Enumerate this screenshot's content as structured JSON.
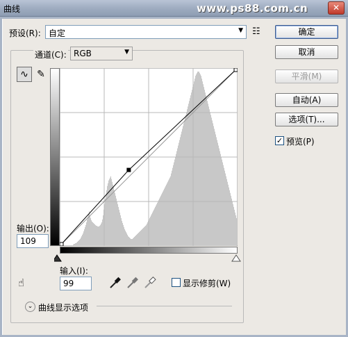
{
  "window": {
    "title": "曲线",
    "watermark": "www.ps88.com.cn",
    "close_glyph": "✕"
  },
  "preset": {
    "label": "预设(R):",
    "value": "自定",
    "menu_icon": "options-menu-icon"
  },
  "channel": {
    "label": "通道(C):",
    "value": "RGB"
  },
  "buttons": {
    "ok": "确定",
    "cancel": "取消",
    "smooth": "平滑(M)",
    "auto": "自动(A)",
    "options": "选项(T)..."
  },
  "preview": {
    "label": "预览(P)",
    "checked": true
  },
  "output": {
    "label": "输出(O):",
    "value": "109"
  },
  "input": {
    "label": "输入(I):",
    "value": "99"
  },
  "show_clipping": {
    "label": "显示修剪(W)",
    "checked": false
  },
  "curve_display": {
    "label": "曲线显示选项"
  },
  "chart_data": {
    "type": "line",
    "xlim": [
      0,
      255
    ],
    "ylim": [
      0,
      255
    ],
    "grid": "4x4",
    "curve_points": [
      {
        "x": 0,
        "y": 0
      },
      {
        "x": 99,
        "y": 109
      },
      {
        "x": 255,
        "y": 255
      }
    ],
    "baseline": [
      {
        "x": 0,
        "y": 0
      },
      {
        "x": 255,
        "y": 255
      }
    ],
    "histogram": [
      0,
      0,
      0,
      0,
      0,
      0,
      0,
      0,
      0,
      0,
      0,
      0,
      0,
      0,
      0,
      0,
      0,
      0,
      1,
      2,
      3,
      3,
      4,
      4,
      5,
      6,
      7,
      8,
      9,
      10,
      12,
      14,
      16,
      18,
      21,
      24,
      27,
      30,
      34,
      38,
      42,
      46,
      50,
      44,
      40,
      37,
      35,
      34,
      33,
      32,
      31,
      30,
      29,
      29,
      28,
      28,
      28,
      29,
      30,
      32,
      34,
      38,
      44,
      52,
      60,
      68,
      74,
      80,
      86,
      90,
      94,
      96,
      98,
      100,
      96,
      92,
      88,
      84,
      80,
      76,
      72,
      68,
      64,
      60,
      56,
      52,
      48,
      44,
      40,
      36,
      33,
      30,
      27,
      24,
      22,
      20,
      18,
      16,
      14,
      13,
      12,
      11,
      10,
      10,
      10,
      11,
      12,
      13,
      14,
      15,
      16,
      17,
      18,
      19,
      20,
      21,
      22,
      23,
      24,
      25,
      26,
      27,
      28,
      29,
      30,
      32,
      34,
      36,
      38,
      40,
      42,
      44,
      46,
      48,
      50,
      52,
      54,
      56,
      58,
      60,
      62,
      64,
      66,
      68,
      70,
      72,
      74,
      76,
      78,
      80,
      82,
      84,
      86,
      88,
      90,
      92,
      94,
      96,
      98,
      100,
      104,
      108,
      112,
      116,
      120,
      124,
      128,
      132,
      136,
      140,
      144,
      148,
      152,
      156,
      160,
      164,
      168,
      172,
      176,
      180,
      184,
      188,
      192,
      196,
      200,
      204,
      208,
      212,
      216,
      220,
      224,
      228,
      232,
      236,
      240,
      244,
      246,
      248,
      250,
      250,
      250,
      248,
      246,
      244,
      240,
      236,
      232,
      228,
      224,
      220,
      216,
      212,
      208,
      204,
      200,
      196,
      192,
      188,
      184,
      180,
      176,
      172,
      168,
      164,
      160,
      156,
      152,
      148,
      144,
      140,
      136,
      132,
      128,
      124,
      120,
      116,
      112,
      108,
      104,
      100,
      96,
      92,
      88,
      84,
      80,
      76,
      72,
      68,
      64,
      60,
      56,
      52,
      48,
      44,
      40,
      0
    ]
  }
}
